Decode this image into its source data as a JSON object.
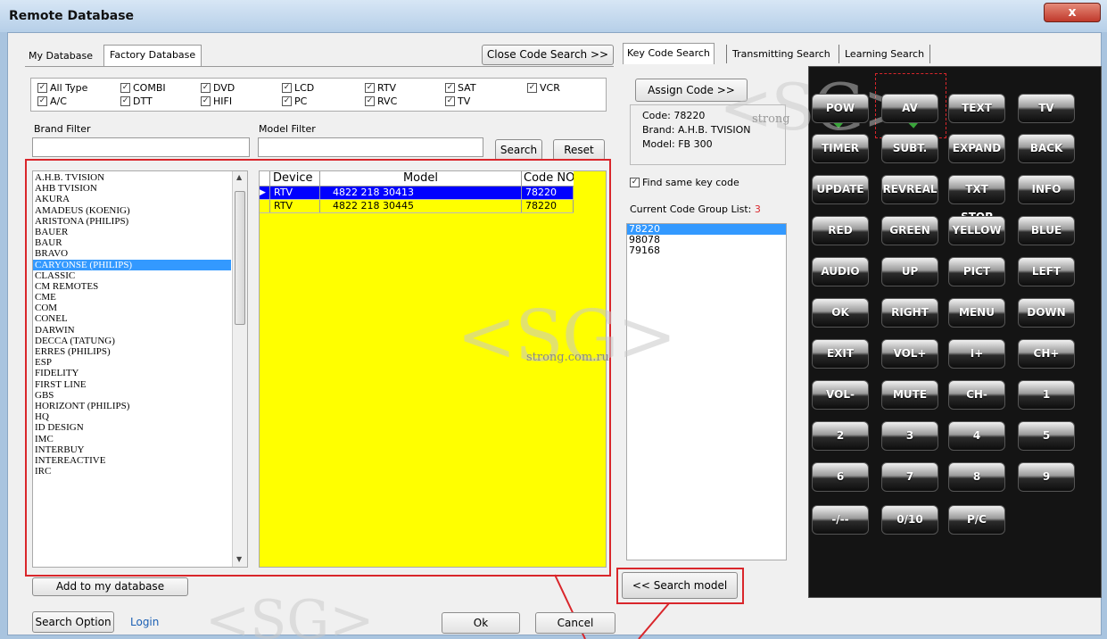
{
  "window": {
    "title": "Remote Database",
    "close": "x"
  },
  "left_tabs": [
    "My Database",
    "Factory Database"
  ],
  "close_code_search": "Close Code Search >>",
  "types": [
    "All Type",
    "COMBI",
    "DVD",
    "LCD",
    "RTV",
    "SAT",
    "VCR",
    "A/C",
    "DTT",
    "HIFI",
    "PC",
    "RVC",
    "TV"
  ],
  "brand_filter": {
    "label": "Brand Filter",
    "value": ""
  },
  "model_filter": {
    "label": "Model Filter",
    "value": ""
  },
  "search_label": "Search",
  "reset_label": "Reset",
  "brands": [
    "A.H.B. TVISION",
    "AHB TVISION",
    "AKURA",
    "AMADEUS (KOENIG)",
    "ARISTONA (PHILIPS)",
    "BAUER",
    "BAUR",
    "BRAVO",
    "CARYONSE (PHILIPS)",
    "CLASSIC",
    "CM REMOTES",
    "CME",
    "COM",
    "CONEL",
    "DARWIN",
    "DECCA (TATUNG)",
    "ERRES (PHILIPS)",
    "ESP",
    "FIDELITY",
    "FIRST LINE",
    "GBS",
    "HORIZONT (PHILIPS)",
    "HQ",
    "ID DESIGN",
    "IMC",
    "INTERBUY",
    "INTEREACTIVE",
    "IRC"
  ],
  "selected_brand": "CARYONSE (PHILIPS)",
  "grid": {
    "headers": [
      "Device",
      "Model",
      "Code NO"
    ],
    "rows": [
      [
        "RTV",
        "4822 218 30413",
        "78220"
      ],
      [
        "RTV",
        "4822 218 30445",
        "78220"
      ]
    ]
  },
  "add_to_db": "Add to my database",
  "right_tabs": [
    "Key Code Search",
    "Transmitting Search",
    "Learning Search"
  ],
  "assign_code": "Assign Code >>",
  "info": {
    "code": "Code:  78220",
    "brand": "Brand:  A.H.B. TVISION",
    "model": "Model:  FB 300"
  },
  "find_same": "Find same key code",
  "group_list_label": "Current Code Group List:",
  "group_count": "3",
  "code_groups": [
    "78220",
    "98078",
    "79168"
  ],
  "search_model": "<< Search model",
  "keys": [
    "POW",
    "AV",
    "TEXT",
    "TV",
    "TIMER",
    "SUBT.",
    "EXPAND",
    "BACK",
    "UPDATE",
    "REVREAL",
    "TXT STOP",
    "INFO",
    "RED",
    "GREEN",
    "YELLOW",
    "BLUE",
    "AUDIO",
    "UP",
    "PICT",
    "LEFT",
    "OK",
    "RIGHT",
    "MENU",
    "DOWN",
    "EXIT",
    "VOL+",
    "I+",
    "CH+",
    "VOL-",
    "MUTE",
    "CH-",
    "1",
    "2",
    "3",
    "4",
    "5",
    "6",
    "7",
    "8",
    "9",
    "-/--",
    "0/10",
    "P/C"
  ],
  "bottom": {
    "search_option": "Search Option",
    "login": "Login",
    "ok": "Ok",
    "cancel": "Cancel"
  },
  "watermarks": {
    "big": "<SG>",
    "small": "strong.com.ru",
    "small2": "strong"
  },
  "colors": {
    "grid_bg": "#ffff00",
    "selection": "#0000ff",
    "highlight_box": "#d9262b",
    "remote_bg": "#141414"
  }
}
